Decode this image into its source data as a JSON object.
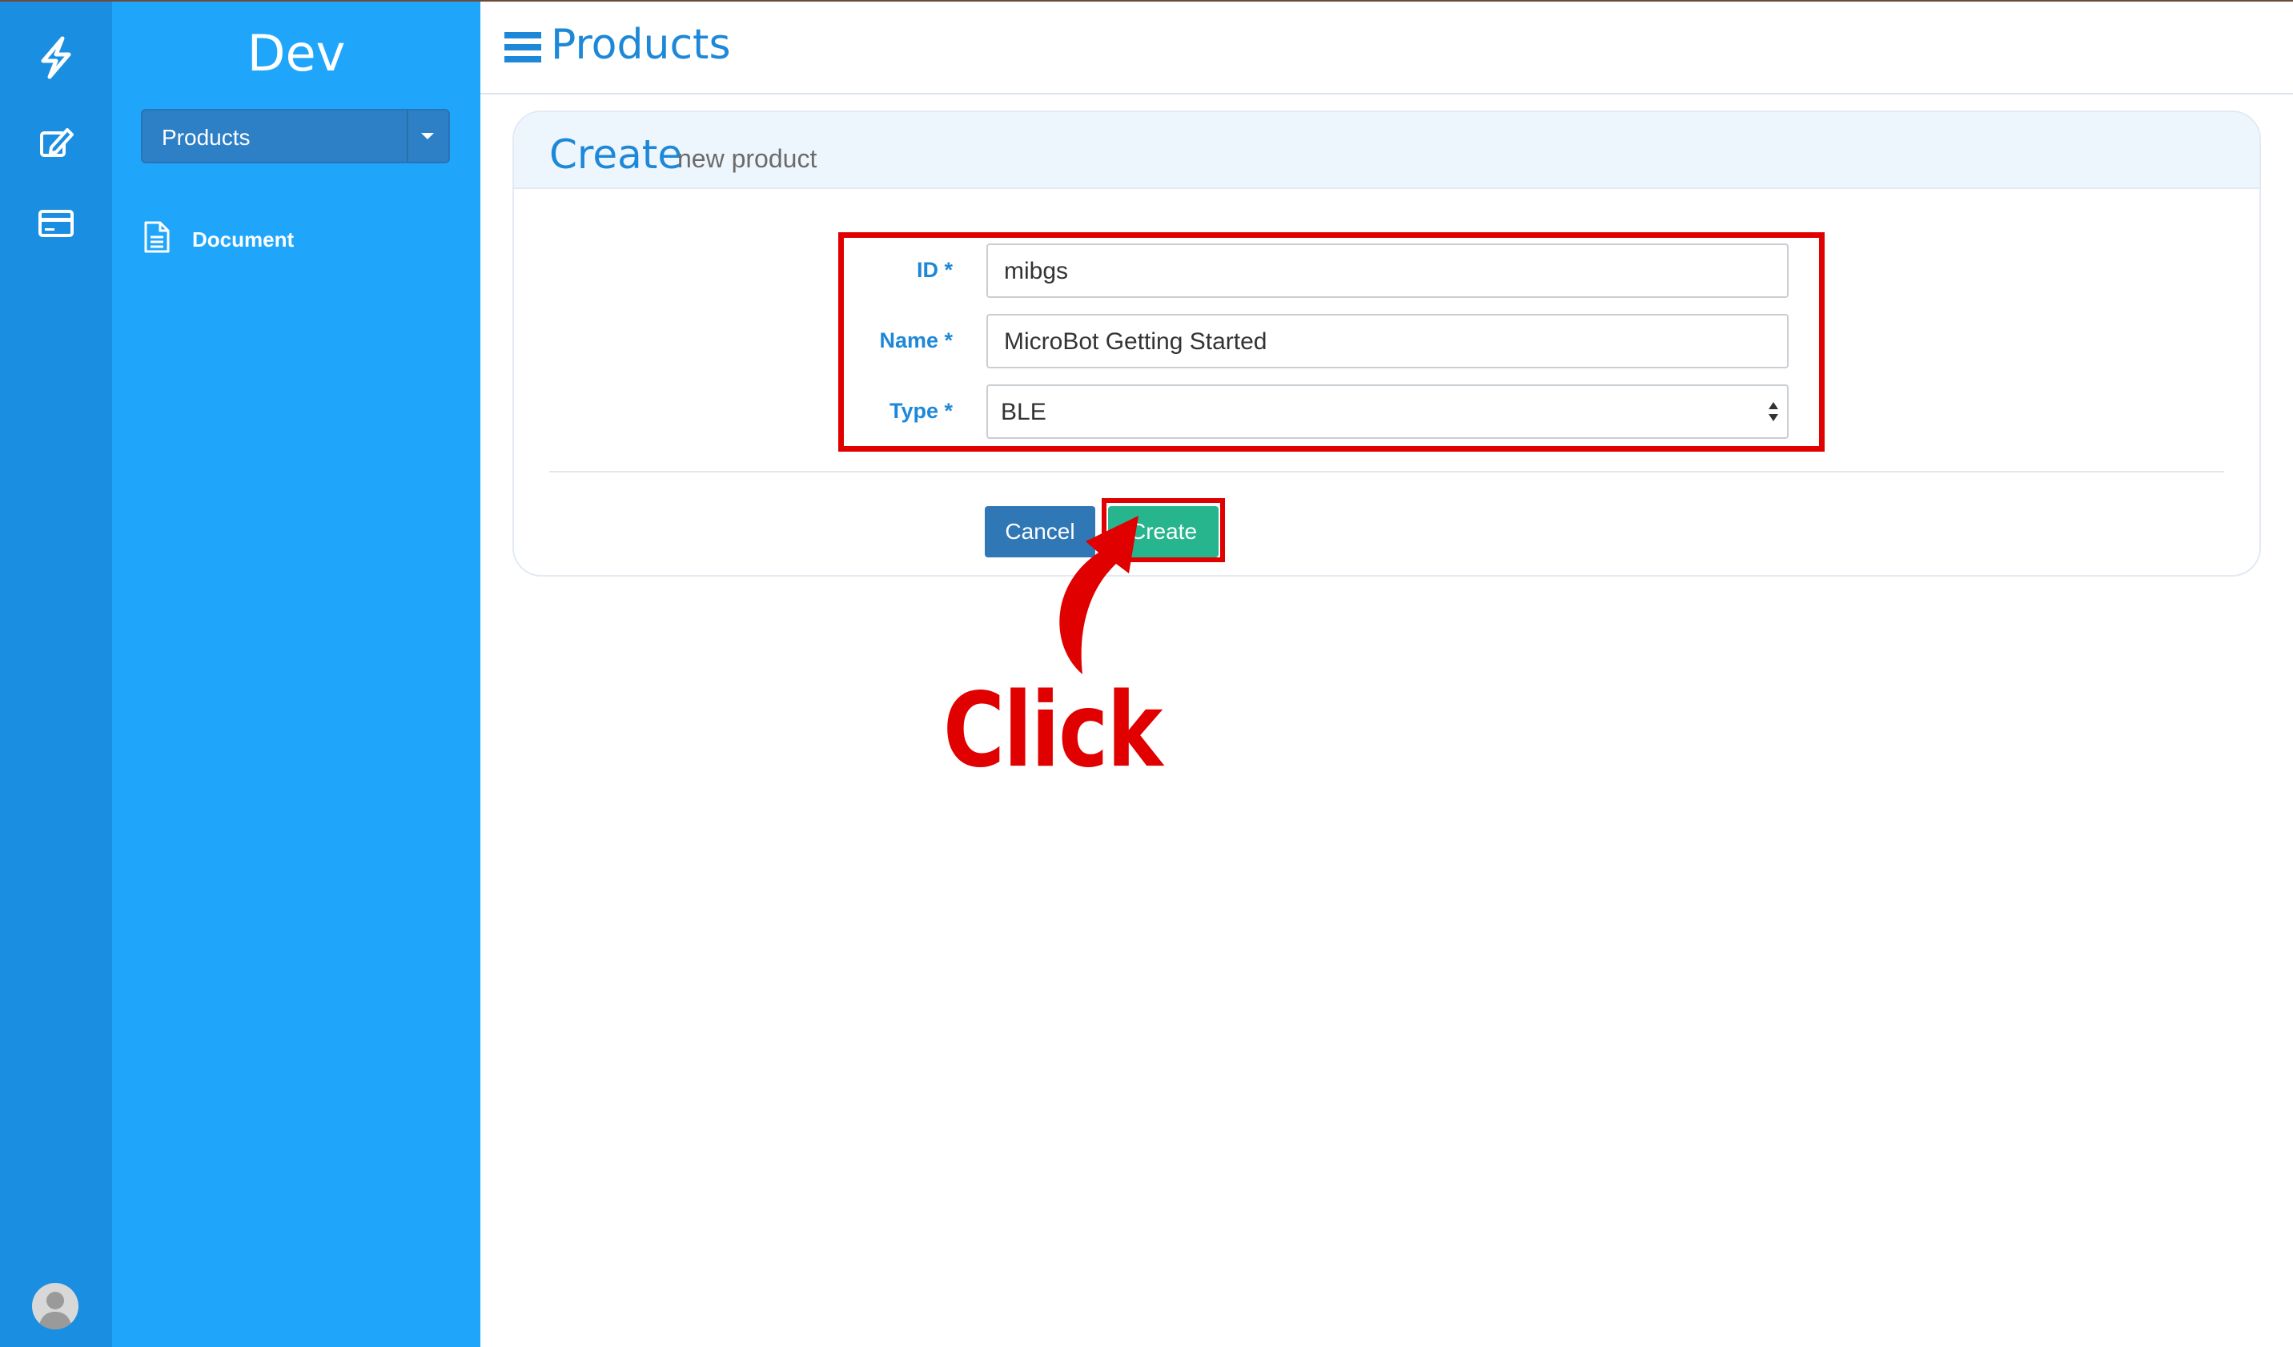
{
  "sidebar": {
    "app_title": "Dev",
    "dropdown_label": "Products",
    "nav_items": [
      {
        "label": "Document",
        "icon": "document-icon"
      }
    ]
  },
  "rail": {
    "icons": [
      "lightning-icon",
      "edit-icon",
      "card-icon"
    ],
    "avatar_icon": "user-avatar-icon"
  },
  "header": {
    "title": "Products",
    "menu_icon": "hamburger-icon"
  },
  "panel": {
    "title": "Create",
    "subtitle": "new product"
  },
  "form": {
    "fields": [
      {
        "label": "ID *",
        "value": "mibgs"
      },
      {
        "label": "Name *",
        "value": "MicroBot Getting Started"
      },
      {
        "label": "Type *",
        "value": "BLE",
        "options_visible": [
          "BLE"
        ]
      }
    ],
    "cancel_label": "Cancel",
    "create_label": "Create"
  },
  "annotation": {
    "text": "Click",
    "color": "#e00000"
  },
  "colors": {
    "rail": "#1a8ee0",
    "sidebar": "#1fa6fb",
    "accent": "#1e88d8",
    "cancel_button": "#2f77b5",
    "create_button": "#27b58d"
  }
}
